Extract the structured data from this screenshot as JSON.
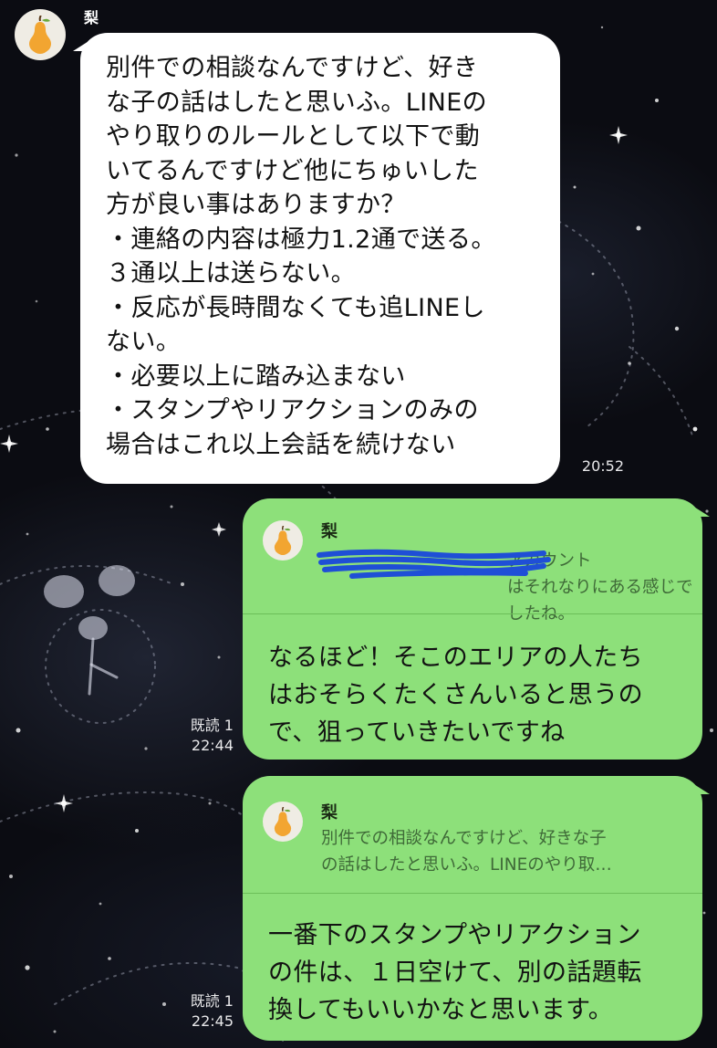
{
  "contact": {
    "name": "梨",
    "avatar_icon": "pear-icon"
  },
  "messages": [
    {
      "type": "incoming",
      "text": "別件での相談なんですけど、好き\nな子の話はしたと思いふ。LINEの\nやり取りのルールとして以下で動\nいてるんですけど他にちゅいした\n方が良い事はありますか？\n・連絡の内容は極力1.2通で送る。\n３通以上は送らない。\n・反応が長時間なくても追LINEし\nない。\n・必要以上に踏み込まない\n・スタンプやリアクションのみの\n場合はこれ以上会話を続けない",
      "time": "20:52"
    },
    {
      "type": "outgoing",
      "quote": {
        "name": "梨",
        "text": "アカウント\nはそれなりにある感じでしたね。"
      },
      "text": "なるほど！そこのエリアの人たち\nはおそらくたくさんいると思うの\nで、狙っていきたいですね",
      "read": "既読 1",
      "time": "22:44"
    },
    {
      "type": "outgoing",
      "quote": {
        "name": "梨",
        "text": "別件での相談なんですけど、好きな子\nの話はしたと思いふ。LINEのやり取…"
      },
      "text": "一番下のスタンプやリアクション\nの件は、１日空けて、別の話題転\n換してもいいかなと思います。",
      "read": "既読 1",
      "time": "22:45"
    }
  ],
  "colors": {
    "outgoing_bubble": "#8de07a",
    "incoming_bubble": "#ffffff",
    "background": "#0b0c12",
    "redaction": "#1f4fd6",
    "pear": "#f2a531"
  }
}
